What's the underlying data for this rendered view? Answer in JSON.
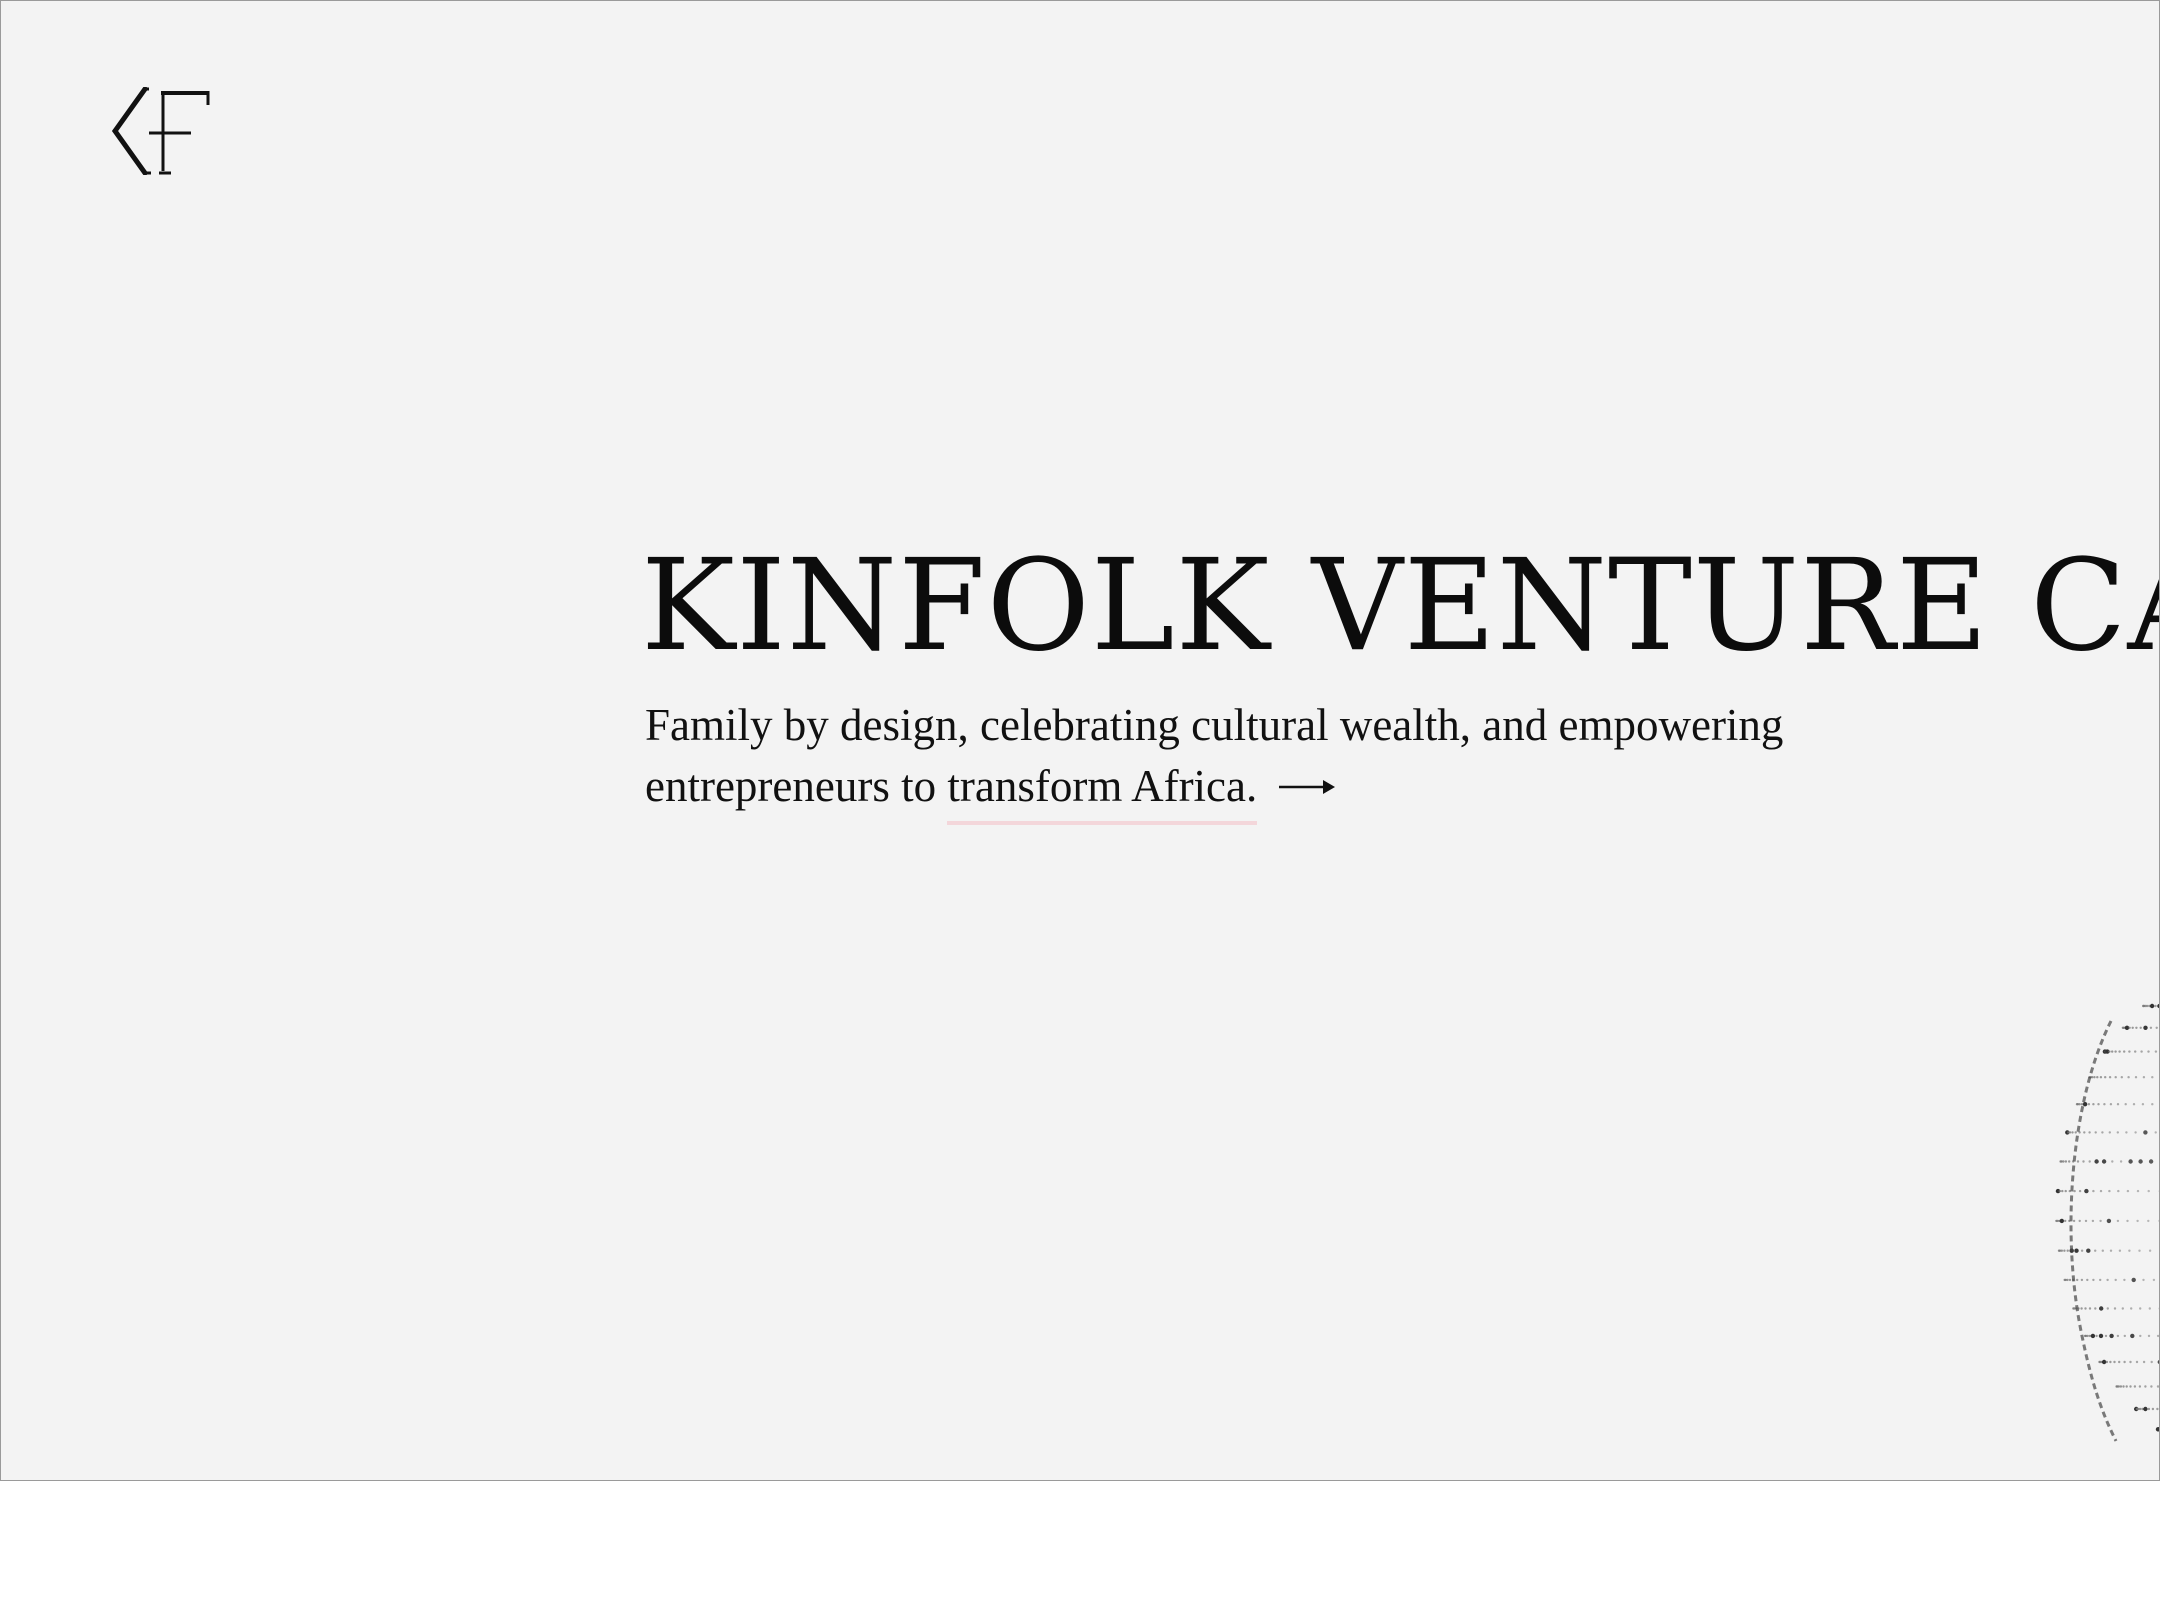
{
  "hero": {
    "title": "KINFOLK VENTURE CAPITAL",
    "tagline_part1": "Family by design, celebrating cultural wealth, and empowering entrepreneurs to ",
    "tagline_link": "transform Africa.",
    "link_underline_color": "#f3d6da"
  },
  "icons": {
    "logo": "kf-monogram-logo",
    "arrow": "right-arrow-icon",
    "globe": "dotted-globe-graphic"
  },
  "colors": {
    "background": "#f3f3f3",
    "text": "#0c0c0c",
    "accent_underline": "#f3d6da"
  }
}
